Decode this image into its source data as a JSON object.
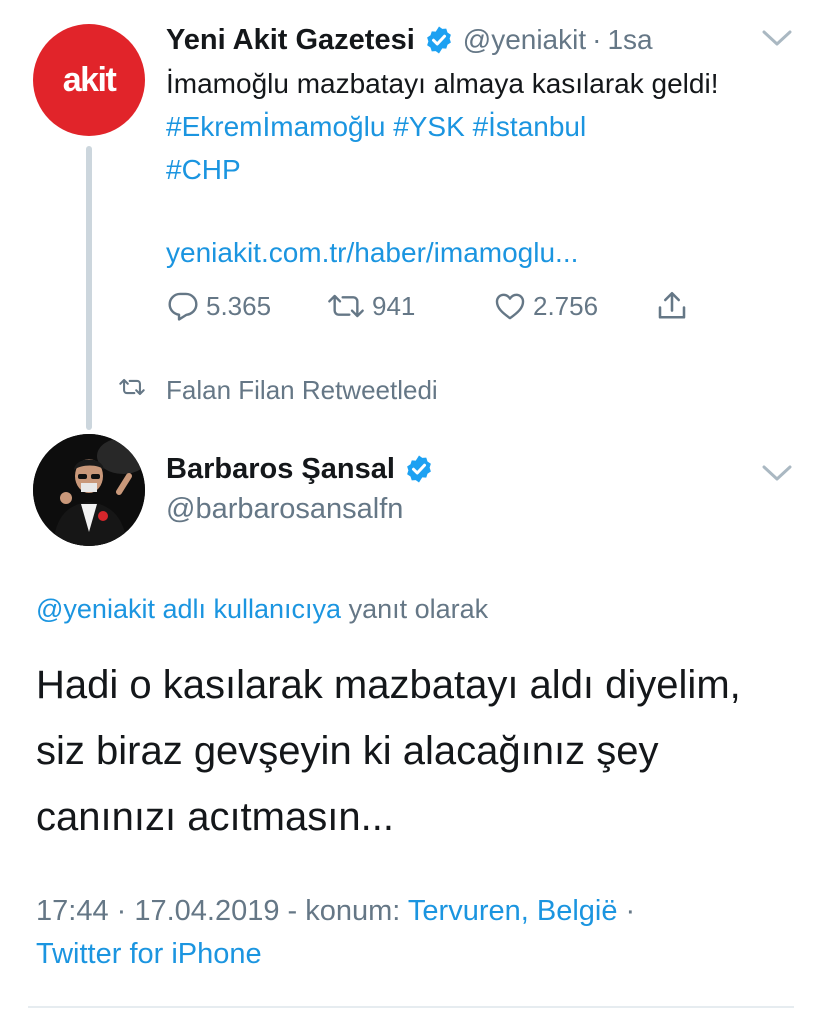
{
  "retweeted_tweet": {
    "avatar_text": "akit",
    "display_name": "Yeni Akit Gazetesi",
    "handle": "@yeniakit",
    "separator": "·",
    "time_ago": "1sa",
    "text_plain": "İmamoğlu mazbatayı almaya kasılarak geldi!",
    "hashtags": [
      "#Ekremİmamoğlu",
      "#YSK",
      "#İstanbul",
      "#CHP"
    ],
    "link": "yeniakit.com.tr/haber/imamoglu...",
    "reply_count": "5.365",
    "retweet_count": "941",
    "like_count": "2.756",
    "verified": true
  },
  "retweet_notice": {
    "label": "Falan Filan Retweetledi"
  },
  "main_tweet": {
    "display_name": "Barbaros Şansal",
    "handle": "@barbarosansalfn",
    "verified": true,
    "reply_to_mention": "@yeniakit adlı kullanıcıya",
    "reply_to_suffix": "yanıt olarak",
    "body_lines": [
      "Hadi o kasılarak mazbatayı aldı diyelim,",
      "siz biraz gevşeyin ki alacağınız şey",
      "canınızı acıtmasın..."
    ],
    "meta_time": "17:44 · 17.04.2019 - konum:",
    "meta_location": "Tervuren, België",
    "meta_separator": "·",
    "meta_source": "Twitter for iPhone"
  },
  "colors": {
    "link_blue": "#1b95e0",
    "secondary_gray": "#657786",
    "akit_red": "#e1242a",
    "verified_blue": "#1da1f2",
    "divider": "#e6ecf0"
  },
  "icons": {
    "reply": "reply-icon",
    "retweet": "retweet-icon",
    "like": "heart-icon",
    "share": "share-icon",
    "verified": "verified-badge-icon",
    "menu": "chevron-down-icon"
  }
}
